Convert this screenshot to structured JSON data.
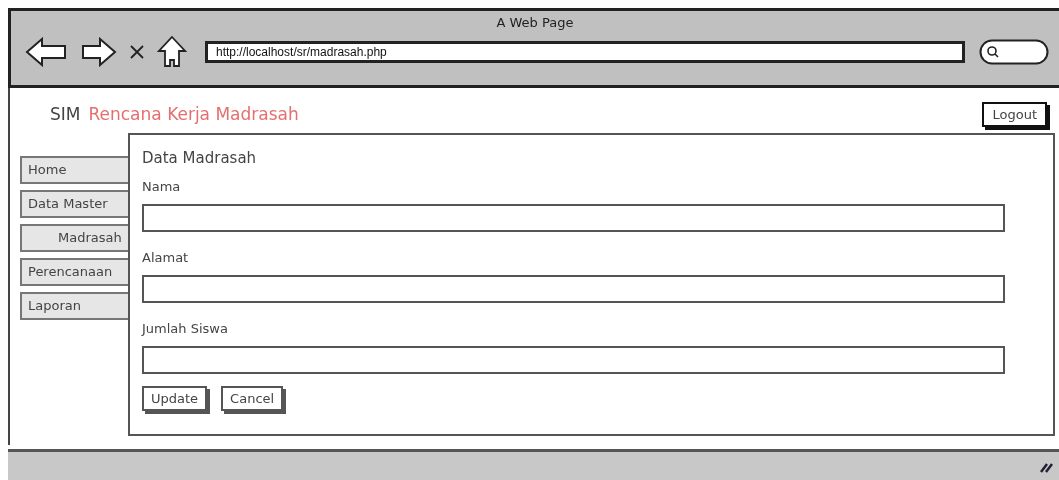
{
  "window": {
    "title": "A Web Page",
    "url": "http://localhost/sr/madrasah.php"
  },
  "header": {
    "prefix": "SIM",
    "title": "Rencana Kerja Madrasah",
    "logout": "Logout"
  },
  "sidebar": {
    "items": [
      {
        "label": "Home"
      },
      {
        "label": "Data Master",
        "children": [
          {
            "label": "Madrasah"
          }
        ]
      },
      {
        "label": "Perencanaan"
      },
      {
        "label": "Laporan"
      }
    ]
  },
  "form": {
    "title": "Data Madrasah",
    "fields": [
      {
        "label": "Nama"
      },
      {
        "label": "Alamat"
      },
      {
        "label": "Jumlah Siswa"
      }
    ],
    "buttons": [
      "Update",
      "Cancel"
    ]
  }
}
